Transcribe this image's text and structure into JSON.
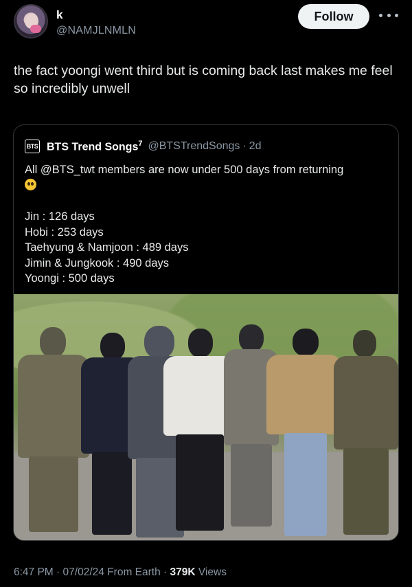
{
  "author": {
    "name": "k",
    "handle": "@NAMJLNMLN"
  },
  "follow_label": "Follow",
  "tweet_text": "the fact yoongi went third but is coming back last makes me feel so incredibly unwell",
  "quoted": {
    "logo_text": "BTS",
    "name": "BTS Trend Songs",
    "name_sup": "7",
    "handle": "@BTSTrendSongs",
    "time": "2d",
    "text": "All @BTS_twt members are now under 500 days from returning",
    "days": [
      "Jin : 126 days",
      "Hobi : 253 days",
      "Taehyung & Namjoon : 489 days",
      "Jimin & Jungkook : 490 days",
      "Yoongi : 500 days"
    ]
  },
  "footer": {
    "time": "6:47 PM",
    "date": "07/02/24",
    "source": "From Earth",
    "views_count": "379K",
    "views_label": "Views"
  },
  "icons": {
    "more": "more-horizontal-icon",
    "emoji": "pleading-face-emoji"
  }
}
